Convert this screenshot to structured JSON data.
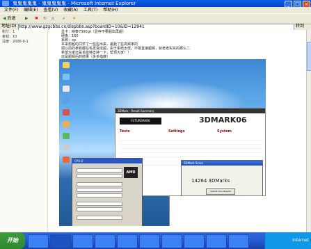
{
  "window": {
    "title": "鬼鬼鬼鬼鬼 - 鬼鬼鬼鬼鬼 - Microsoft Internet Explorer",
    "min": "_",
    "max": "□",
    "close": "×"
  },
  "menu": [
    "文件(F)",
    "编辑(E)",
    "查看(V)",
    "收藏(A)",
    "工具(T)",
    "帮助(H)"
  ],
  "toolbar": {
    "back": "后退",
    "forward": "",
    "stop": "",
    "refresh": "",
    "home": "",
    "search": "",
    "favorites": ""
  },
  "address": {
    "label": "地址(D)",
    "url": "http://www.gzgcbbs.cn/dispbbs.asp?boardID=10&ID=12941",
    "go": "转到"
  },
  "sidebar": {
    "lines": [
      "积分：1",
      "金钱：10",
      "注册：2006-9-1"
    ]
  },
  "post": {
    "lines": [
      "显卡：映泰7300gt（显存不要超出再超）",
      "硬盘：160",
      "系统：xp",
      "本来想超的同学了一些些出来，差距了些高频率的",
      "把以前的参数都在毛发变成超，由于系统太低，不敢直接超频，就老老实实的那么二",
      "希望大家还是多能够支持一下，帮顶大家！！",
      "这是超频后的结果（多多指教）"
    ]
  },
  "screenshot": {
    "dm_title": "3DMark - Result Summary",
    "dm_logo": "3DMARK06",
    "dm_brand": "FUTUREMARK",
    "dm_cols": [
      "Tests",
      "Settings",
      "System"
    ],
    "cpuz_title": "CPU-Z",
    "cpuz_logo": "AMD",
    "score_title": "3DMark Score",
    "score_value": "14264 3DMarks",
    "score_btn": "Submit Your Results"
  },
  "status": {
    "zone": "Internet"
  },
  "taskbar": {
    "start": "开始",
    "clock": ""
  }
}
